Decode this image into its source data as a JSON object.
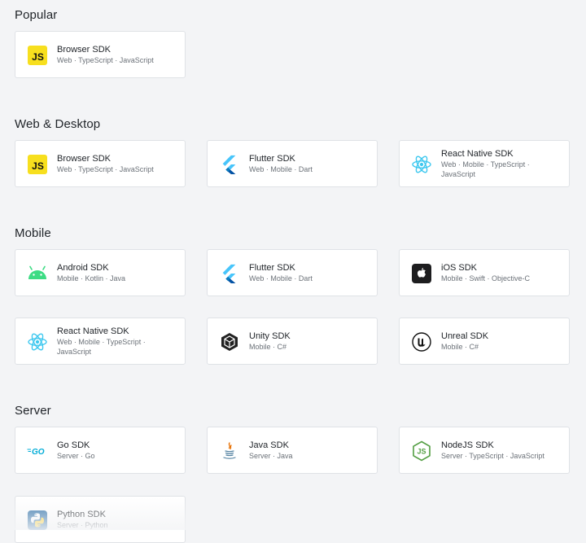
{
  "sections": [
    {
      "title": "Popular",
      "cards": [
        {
          "name": "Browser SDK",
          "tags": "Web · TypeScript · JavaScript",
          "icon": "javascript-icon"
        }
      ]
    },
    {
      "title": "Web & Desktop",
      "cards": [
        {
          "name": "Browser SDK",
          "tags": "Web · TypeScript · JavaScript",
          "icon": "javascript-icon"
        },
        {
          "name": "Flutter SDK",
          "tags": "Web · Mobile · Dart",
          "icon": "flutter-icon"
        },
        {
          "name": "React Native SDK",
          "tags": "Web · Mobile · TypeScript · JavaScript",
          "icon": "react-icon"
        }
      ]
    },
    {
      "title": "Mobile",
      "cards": [
        {
          "name": "Android SDK",
          "tags": "Mobile · Kotlin · Java",
          "icon": "android-icon"
        },
        {
          "name": "Flutter SDK",
          "tags": "Web · Mobile · Dart",
          "icon": "flutter-icon"
        },
        {
          "name": "iOS SDK",
          "tags": "Mobile · Swift · Objective-C",
          "icon": "apple-icon"
        },
        {
          "name": "React Native SDK",
          "tags": "Web · Mobile · TypeScript · JavaScript",
          "icon": "react-icon"
        },
        {
          "name": "Unity SDK",
          "tags": "Mobile · C#",
          "icon": "unity-icon"
        },
        {
          "name": "Unreal SDK",
          "tags": "Mobile · C#",
          "icon": "unreal-icon"
        }
      ]
    },
    {
      "title": "Server",
      "cards": [
        {
          "name": "Go SDK",
          "tags": "Server · Go",
          "icon": "go-icon"
        },
        {
          "name": "Java SDK",
          "tags": "Server · Java",
          "icon": "java-icon"
        },
        {
          "name": "NodeJS SDK",
          "tags": "Server · TypeScript · JavaScript",
          "icon": "nodejs-icon"
        },
        {
          "name": "Python SDK",
          "tags": "Server · Python",
          "icon": "python-icon"
        }
      ]
    }
  ]
}
